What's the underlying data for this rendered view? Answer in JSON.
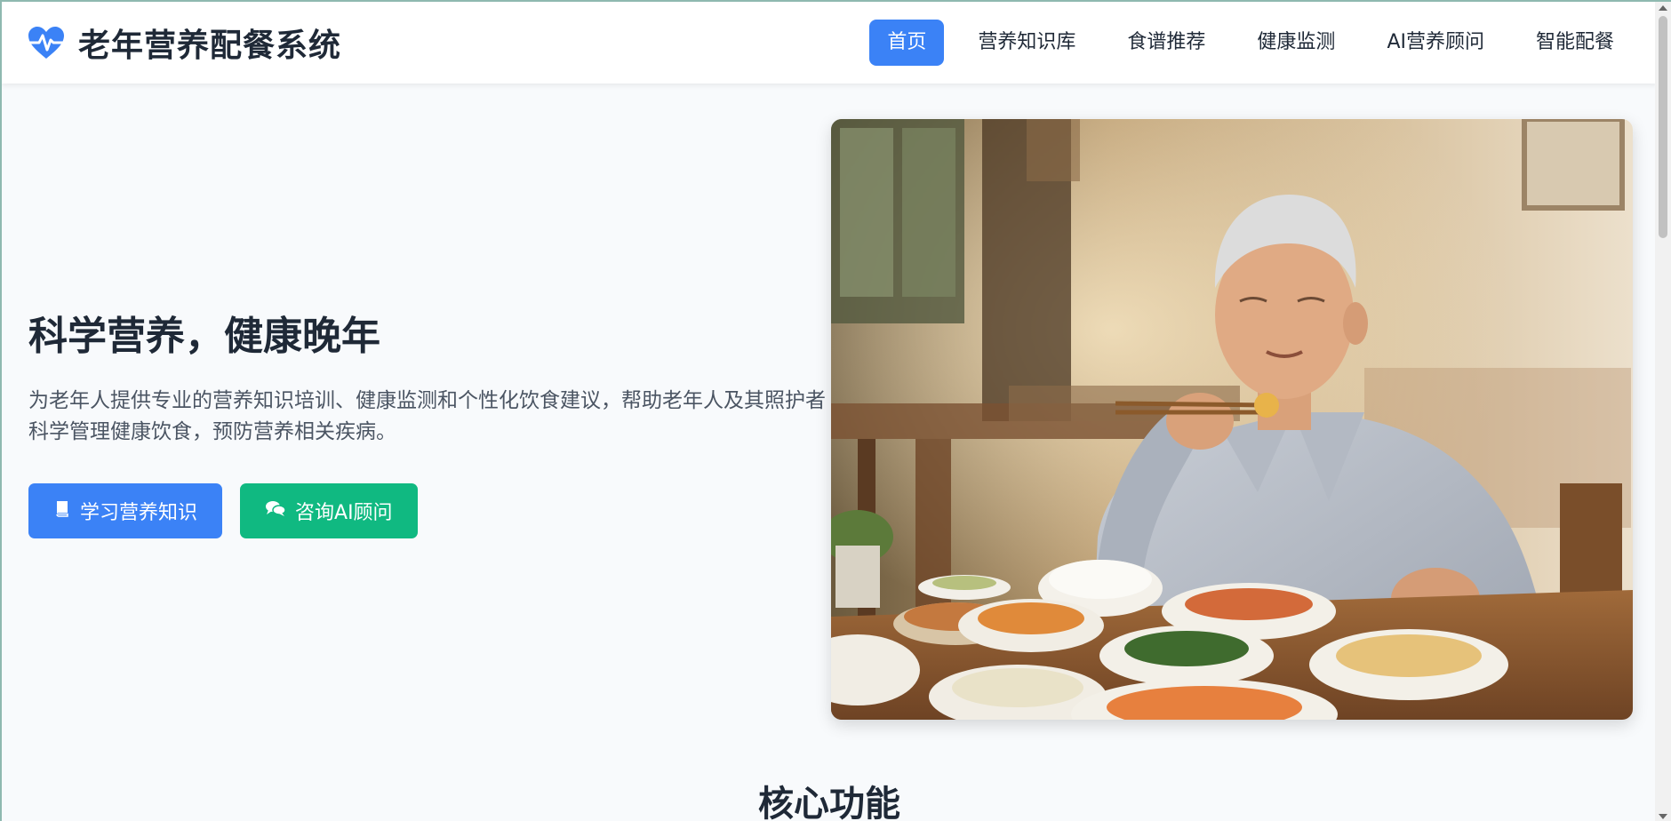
{
  "brand": {
    "title": "老年营养配餐系统",
    "icon": "heartbeat-icon",
    "accent": "#3b82f6"
  },
  "nav": {
    "items": [
      {
        "label": "首页",
        "active": true
      },
      {
        "label": "营养知识库",
        "active": false
      },
      {
        "label": "食谱推荐",
        "active": false
      },
      {
        "label": "健康监测",
        "active": false
      },
      {
        "label": "AI营养顾问",
        "active": false
      },
      {
        "label": "智能配餐",
        "active": false
      }
    ]
  },
  "hero": {
    "title": "科学营养，健康晚年",
    "description": "为老年人提供专业的营养知识培训、健康监测和个性化饮食建议，帮助老年人及其照护者科学管理健康饮食，预防营养相关疾病。",
    "buttons": {
      "learn": {
        "label": "学习营养知识",
        "icon": "book-icon",
        "color": "#3b82f6"
      },
      "consult": {
        "label": "咨询AI顾问",
        "icon": "chat-icon",
        "color": "#10b981"
      }
    }
  },
  "features": {
    "title": "核心功能"
  }
}
